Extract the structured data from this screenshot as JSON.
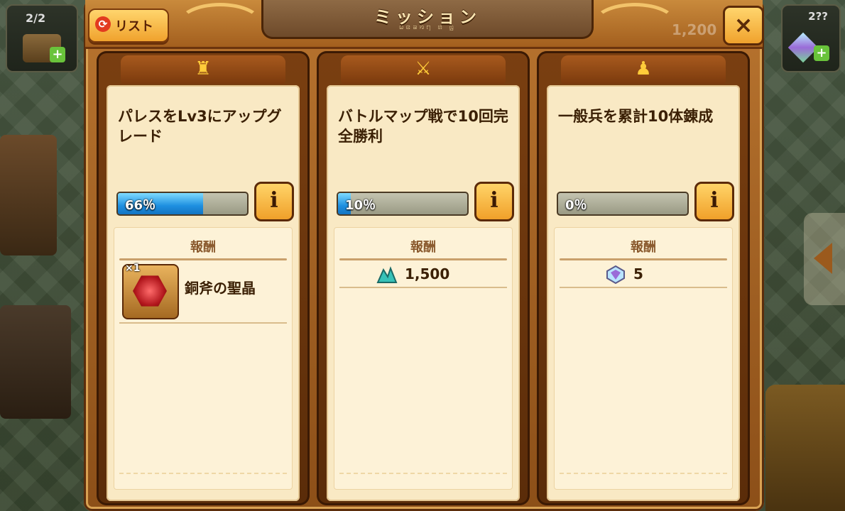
{
  "header": {
    "title": "ミッション",
    "subtitle_rune": "ꤗꤕꤘꤙꤚ ꤛ ꤜ",
    "list_button": "リスト",
    "close_icon": "×"
  },
  "hud": {
    "left_count": "2/2",
    "right_count": "2??",
    "faded_number": "1,200",
    "plus": "+"
  },
  "colors": {
    "frame": "#b8742f",
    "panel": "#f9e9c4",
    "progress_fill": "#1e8fe0",
    "button": "#f0a22d"
  },
  "missions": [
    {
      "category_icon": "palace-icon",
      "category_glyph": "♜",
      "description": "パレスをLv3にアップグレード",
      "progress_pct": 66,
      "progress_label": "66％",
      "info_label": "i",
      "reward_title": "報酬",
      "reward": {
        "type": "item",
        "quantity": "×1",
        "name": "銅斧の聖晶"
      }
    },
    {
      "category_icon": "crossed-swords-icon",
      "category_glyph": "⚔",
      "description": "バトルマップ戦で10回完全勝利",
      "progress_pct": 10,
      "progress_label": "10％",
      "info_label": "i",
      "reward_title": "報酬",
      "reward": {
        "type": "resource",
        "icon": "crystal-pile-icon",
        "amount": "1,500"
      }
    },
    {
      "category_icon": "soldier-icon",
      "category_glyph": "♟",
      "description": "一般兵を累計10体錬成",
      "progress_pct": 0,
      "progress_label": "0％",
      "info_label": "i",
      "reward_title": "報酬",
      "reward": {
        "type": "resource",
        "icon": "gem-icon",
        "amount": "5"
      }
    }
  ]
}
